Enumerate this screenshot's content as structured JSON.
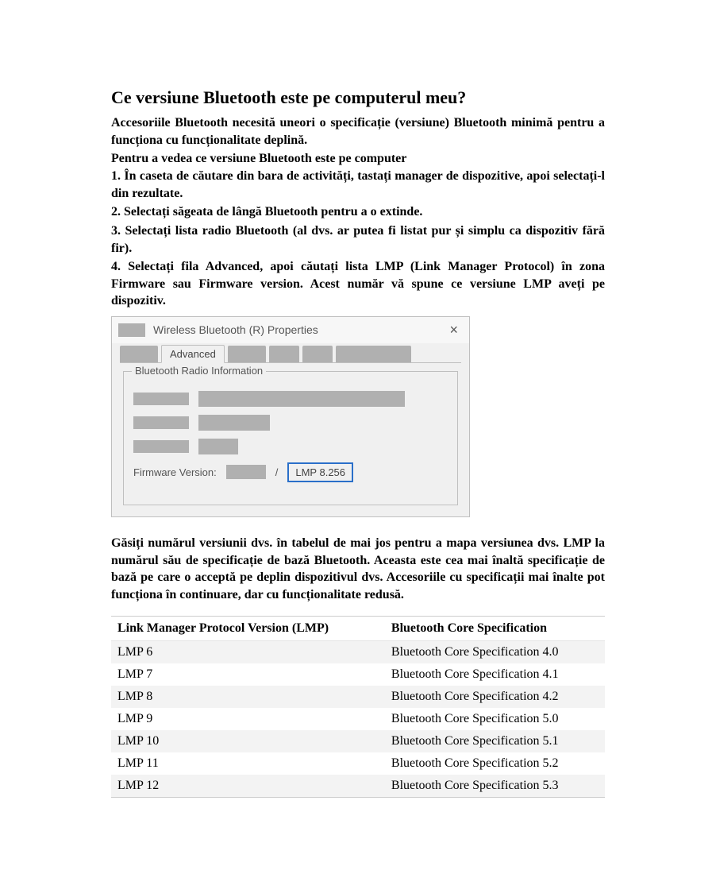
{
  "title": "Ce versiune Bluetooth este pe computerul meu?",
  "intro": "Accesoriile Bluetooth necesită uneori o specificație (versiune) Bluetooth minimă pentru a funcționa cu funcționalitate deplină.",
  "subhead": "Pentru a vedea ce versiune Bluetooth este pe computer",
  "steps": [
    "1. În caseta de căutare din bara de activități, tastați manager de dispozitive, apoi selectați-l din rezultate.",
    "2. Selectați săgeata de lângă Bluetooth pentru a o extinde.",
    "3. Selectați lista radio Bluetooth (al dvs. ar putea fi listat pur și simplu ca dispozitiv fără fir).",
    "4. Selectați fila Advanced, apoi căutați lista LMP (Link Manager Protocol) în zona Firmware sau Firmware version. Acest număr vă spune ce versiune LMP aveți pe dispozitiv."
  ],
  "dialog": {
    "title": "Wireless Bluetooth (R) Properties",
    "close": "×",
    "active_tab": "Advanced",
    "group_label": "Bluetooth Radio Information",
    "firmware_label": "Firmware Version:",
    "slash": "/",
    "lmp_value": "LMP 8.256"
  },
  "below": "Găsiți numărul versiunii dvs. în tabelul de mai jos pentru a mapa versiunea dvs. LMP la numărul său de specificație de bază Bluetooth. Aceasta este cea mai înaltă specificație de bază pe care o acceptă pe deplin dispozitivul dvs. Accesoriile cu specificații mai înalte pot funcționa în continuare, dar cu funcționalitate redusă.",
  "table": {
    "headers": [
      "Link Manager Protocol Version (LMP)",
      "Bluetooth Core Specification"
    ],
    "rows": [
      [
        "LMP 6",
        "Bluetooth Core Specification 4.0"
      ],
      [
        "LMP 7",
        "Bluetooth Core Specification 4.1"
      ],
      [
        "LMP 8",
        "Bluetooth Core Specification 4.2"
      ],
      [
        "LMP 9",
        "Bluetooth Core Specification 5.0"
      ],
      [
        "LMP 10",
        "Bluetooth Core Specification 5.1"
      ],
      [
        "LMP 11",
        "Bluetooth Core Specification 5.2"
      ],
      [
        "LMP 12",
        "Bluetooth Core Specification 5.3"
      ]
    ]
  }
}
